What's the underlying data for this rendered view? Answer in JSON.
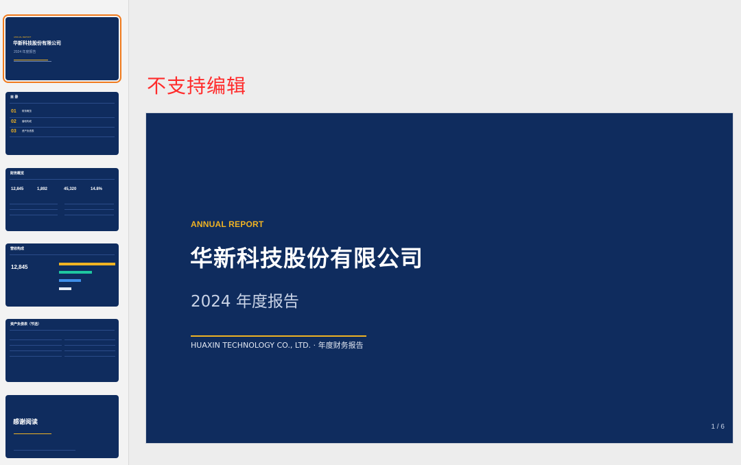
{
  "notice": "不支持编辑",
  "slide": {
    "kicker": "ANNUAL REPORT",
    "company": "华新科技股份有限公司",
    "subtitle": "2024 年度报告",
    "english_line": "HUAXIN TECHNOLOGY CO., LTD. · 年度财务报告",
    "page_indicator": "1 / 6",
    "accent_color": "#f0b323",
    "background_color": "#0f2c5e"
  },
  "thumbnails": {
    "t1": {
      "kicker": "ANNUAL REPORT",
      "company": "华新科技股份有限公司",
      "subtitle": "2024 年度报告"
    },
    "t2": {
      "title": "目 录",
      "items": [
        {
          "num": "01",
          "label": "财务概览"
        },
        {
          "num": "02",
          "label": "营收构成"
        },
        {
          "num": "03",
          "label": "资产负债表"
        }
      ]
    },
    "t3": {
      "title": "财务概览",
      "kpis": [
        "12,845",
        "1,892",
        "45,320",
        "14.8%"
      ]
    },
    "t4": {
      "title": "营收构成",
      "value": "12,845"
    },
    "t5": {
      "title": "资产负债表（节选）"
    },
    "t6": {
      "title": "感谢阅读"
    }
  }
}
